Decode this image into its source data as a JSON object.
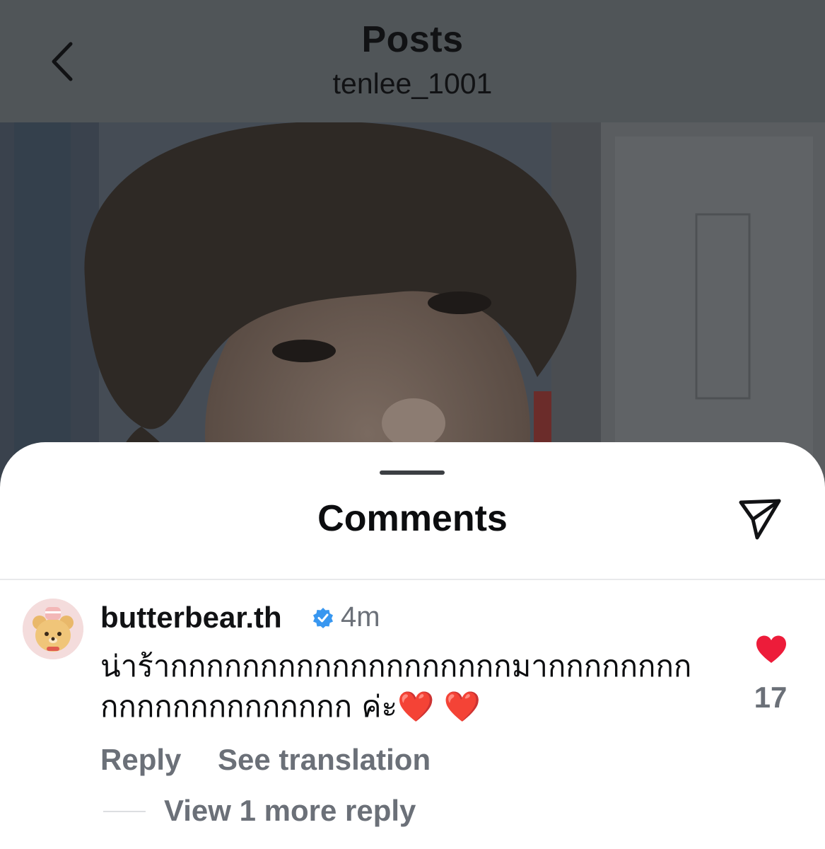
{
  "header": {
    "title": "Posts",
    "subtitle": "tenlee_1001",
    "back_icon": "chevron-left-icon"
  },
  "photo": {
    "description_icon": "post-photo"
  },
  "sheet": {
    "title": "Comments",
    "share_icon": "send-icon"
  },
  "comment": {
    "username": "butterbear.th",
    "verified_icon": "verified-badge-icon",
    "time": "4m",
    "text": "น่าร้ากกกกกกกกกกกกกกกกกกกมากกกกกกกกกกกกกกกกกกกกกก ค่ะ❤️ ❤️",
    "likes": "17",
    "like_icon": "heart-filled-icon",
    "reply_label": "Reply",
    "translate_label": "See translation",
    "view_replies_label": "View 1 more reply"
  },
  "colors": {
    "dim_overlay": "#505558",
    "heart": "#ed1c3a",
    "verified": "#3897f0",
    "secondary_text": "#6b7078"
  }
}
